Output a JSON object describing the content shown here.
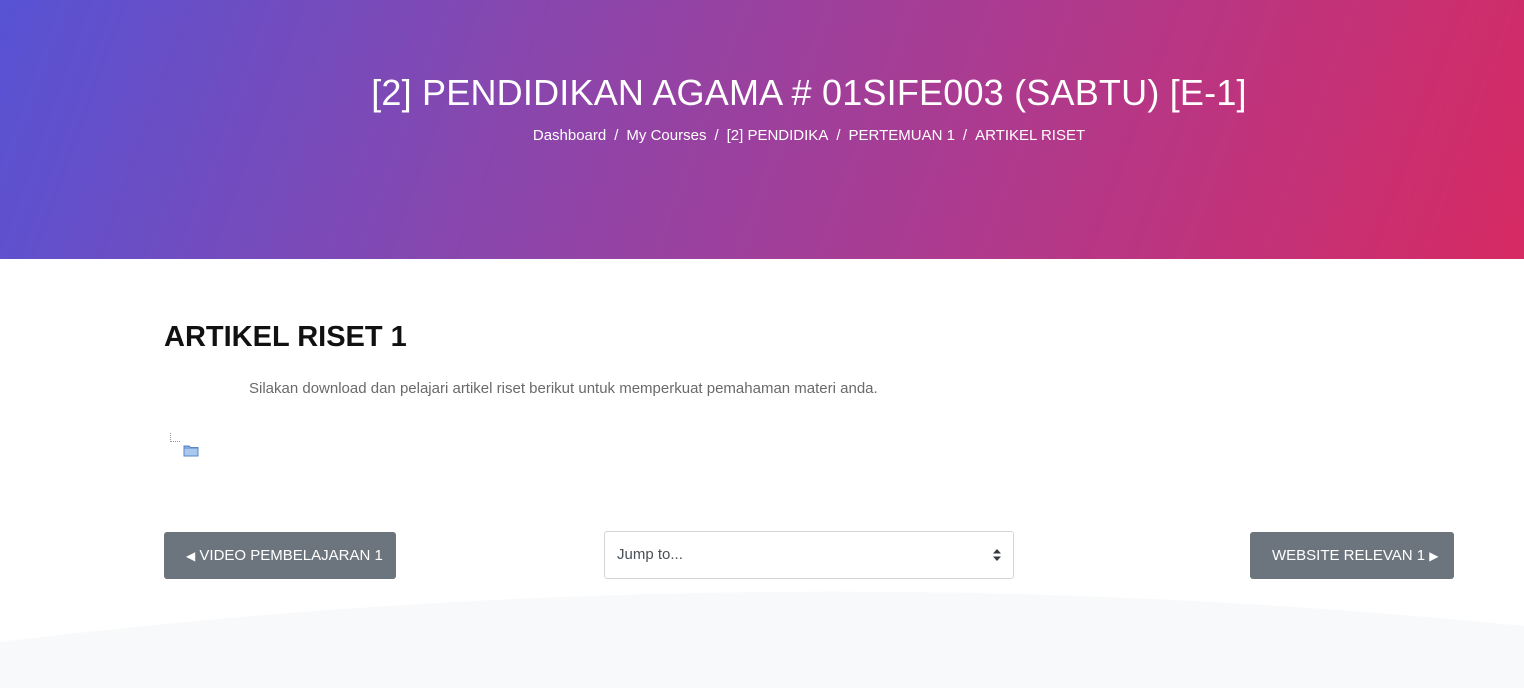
{
  "header": {
    "title": "[2] PENDIDIKAN AGAMA # 01SIFE003 (SABTU) [E-1]",
    "breadcrumb": [
      "Dashboard",
      "My Courses",
      "[2] PENDIDIKA",
      "PERTEMUAN 1",
      "ARTIKEL RISET"
    ],
    "separator": "/"
  },
  "main": {
    "title": "ARTIKEL RISET 1",
    "intro": "Silakan download dan pelajari artikel riset berikut untuk memperkuat pemahaman materi anda."
  },
  "nav": {
    "prev_label": "VIDEO PEMBELAJARAN 1",
    "prev_arrow": "◀",
    "jump_placeholder": "Jump to...",
    "next_label": "WEBSITE RELEVAN 1",
    "next_arrow": "▶"
  },
  "colors": {
    "gradient_start": "#5753d4",
    "gradient_end": "#d62a63",
    "button_bg": "#6c757d"
  },
  "icons": {
    "folder": "folder-icon",
    "select_caret": "sort-caret-icon"
  }
}
